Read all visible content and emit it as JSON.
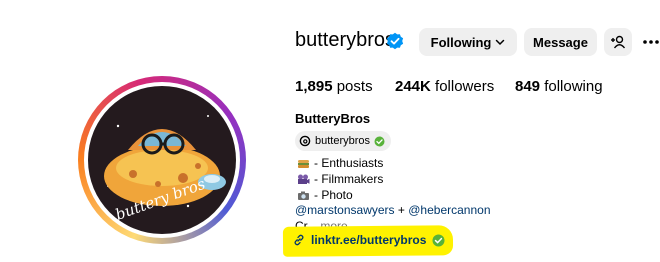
{
  "profile": {
    "username": "butterybros",
    "full_name": "ButteryBros",
    "threads_handle": "butterybros",
    "avatar_text": "buttery bros"
  },
  "actions": {
    "following_label": "Following",
    "message_label": "Message"
  },
  "stats": {
    "posts_count": "1,895",
    "posts_label": "posts",
    "followers_count": "244K",
    "followers_label": "followers",
    "following_count": "849",
    "following_label": "following"
  },
  "bio": {
    "lines": [
      "- Enthusiasts",
      "- Filmmakers",
      "- Photo"
    ],
    "mention_1": "@marstonsawyers",
    "plus": "+",
    "mention_2": "@hebercannon",
    "truncated": "Cr...",
    "more_label": "more",
    "link": "linktr.ee/butterybros"
  },
  "colors": {
    "verified_blue": "#0095f6",
    "link_blue": "#00376b",
    "highlight_yellow": "#fff200",
    "button_gray": "#efefef",
    "link_check_green": "#58b23a"
  },
  "icons": [
    "verified-badge-icon",
    "chevron-down-icon",
    "add-user-icon",
    "more-options-icon",
    "threads-icon",
    "link-icon",
    "check-icon"
  ]
}
